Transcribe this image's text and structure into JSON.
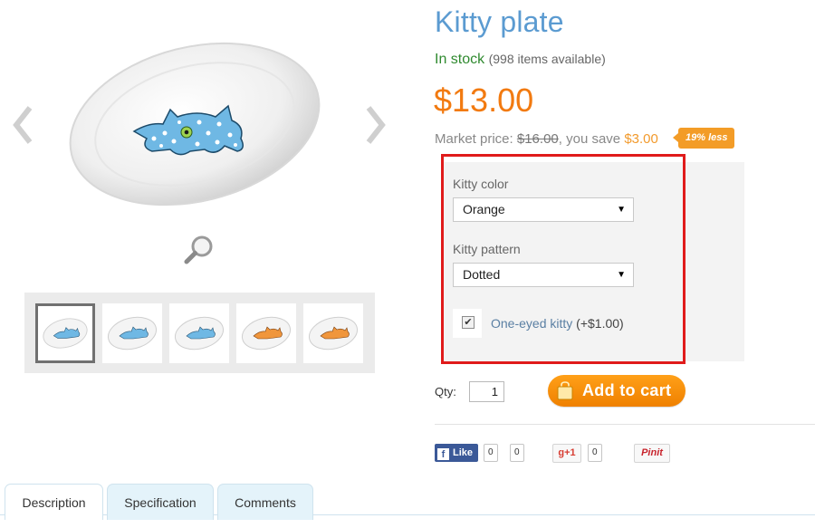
{
  "product": {
    "title": "Kitty plate",
    "stock_status": "In stock",
    "stock_count": "(998 items available)",
    "price": "$13.00",
    "market_label": "Market price:",
    "market_price": "$16.00",
    "save_label": ", you save",
    "save_amount": "$3.00",
    "discount_badge": "19% less"
  },
  "options": {
    "color_label": "Kitty color",
    "color_value": "Orange",
    "pattern_label": "Kitty pattern",
    "pattern_value": "Dotted",
    "extra_label": "One-eyed kitty",
    "extra_price": "(+$1.00)",
    "extra_checked": true
  },
  "purchase": {
    "qty_label": "Qty:",
    "qty_value": "1",
    "cart_label": "Add to cart"
  },
  "social": {
    "fb_label": "Like",
    "fb_count": "0",
    "fb_share_count": "0",
    "gplus_label": "g+1",
    "gplus_count": "0",
    "pin_label": "Pinit"
  },
  "tabs": [
    {
      "label": "Description",
      "active": true
    },
    {
      "label": "Specification",
      "active": false
    },
    {
      "label": "Comments",
      "active": false
    }
  ],
  "thumbnails": [
    {
      "kitty_color": "#6fb8e4",
      "selected": true
    },
    {
      "kitty_color": "#6fb8e4",
      "selected": false
    },
    {
      "kitty_color": "#6fb8e4",
      "selected": false
    },
    {
      "kitty_color": "#f0963c",
      "selected": false
    },
    {
      "kitty_color": "#f0963c",
      "selected": false
    }
  ],
  "colors": {
    "title": "#5b9bd1",
    "in_stock": "#2f8a2f",
    "price": "#f27a10",
    "highlight_border": "#e01b1b",
    "cart_button": "#f39010",
    "kitty_blue": "#6fb8e4"
  }
}
